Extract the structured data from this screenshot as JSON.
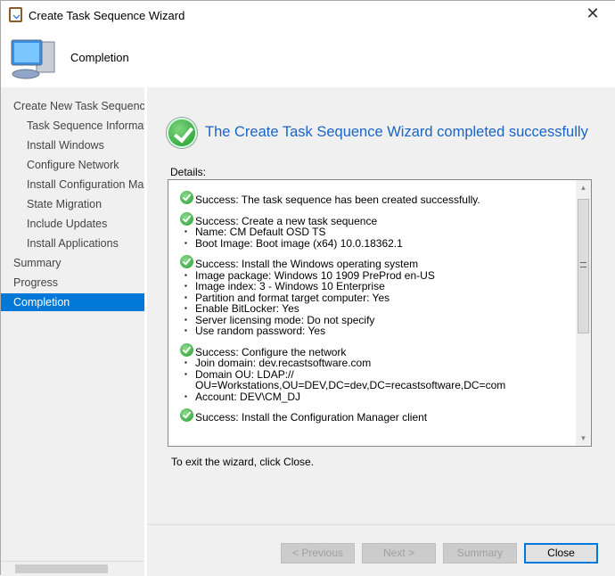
{
  "window": {
    "title": "Create Task Sequence Wizard",
    "close_label": "✕"
  },
  "header": {
    "title": "Completion"
  },
  "sidebar": {
    "items": [
      {
        "label": "Create New Task Sequence",
        "level": 0,
        "selected": false
      },
      {
        "label": "Task Sequence Information",
        "level": 1,
        "selected": false
      },
      {
        "label": "Install Windows",
        "level": 1,
        "selected": false
      },
      {
        "label": "Configure Network",
        "level": 1,
        "selected": false
      },
      {
        "label": "Install Configuration Manager",
        "level": 1,
        "selected": false
      },
      {
        "label": "State Migration",
        "level": 1,
        "selected": false
      },
      {
        "label": "Include Updates",
        "level": 1,
        "selected": false
      },
      {
        "label": "Install Applications",
        "level": 1,
        "selected": false
      },
      {
        "label": "Summary",
        "level": 0,
        "selected": false
      },
      {
        "label": "Progress",
        "level": 0,
        "selected": false
      },
      {
        "label": "Completion",
        "level": 0,
        "selected": true
      }
    ]
  },
  "main": {
    "headline": "The Create Task Sequence Wizard completed successfully",
    "details_label": "Details:",
    "details": [
      {
        "title": "Success: The task sequence has been created successfully.",
        "items": []
      },
      {
        "title": "Success: Create a new task sequence",
        "items": [
          "Name: CM Default OSD TS",
          "Boot Image: Boot image (x64) 10.0.18362.1"
        ]
      },
      {
        "title": "Success: Install the Windows operating system",
        "items": [
          "Image package: Windows 10 1909 PreProd  en-US",
          "Image index: 3 - Windows 10 Enterprise",
          "Partition and format target computer: Yes",
          "Enable BitLocker: Yes",
          "Server licensing mode: Do not specify",
          "Use random password: Yes"
        ]
      },
      {
        "title": "Success: Configure the network",
        "items": [
          "Join domain: dev.recastsoftware.com",
          "Domain OU: LDAP:// OU=Workstations,OU=DEV,DC=dev,DC=recastsoftware,DC=com",
          "Account: DEV\\CM_DJ"
        ]
      },
      {
        "title": "Success: Install the Configuration Manager client",
        "items": []
      }
    ],
    "exit_text": "To exit the wizard, click Close."
  },
  "buttons": {
    "previous": "< Previous",
    "next": "Next >",
    "summary": "Summary",
    "close": "Close"
  },
  "colors": {
    "accent": "#0078d7",
    "headline": "#1a64c8"
  }
}
